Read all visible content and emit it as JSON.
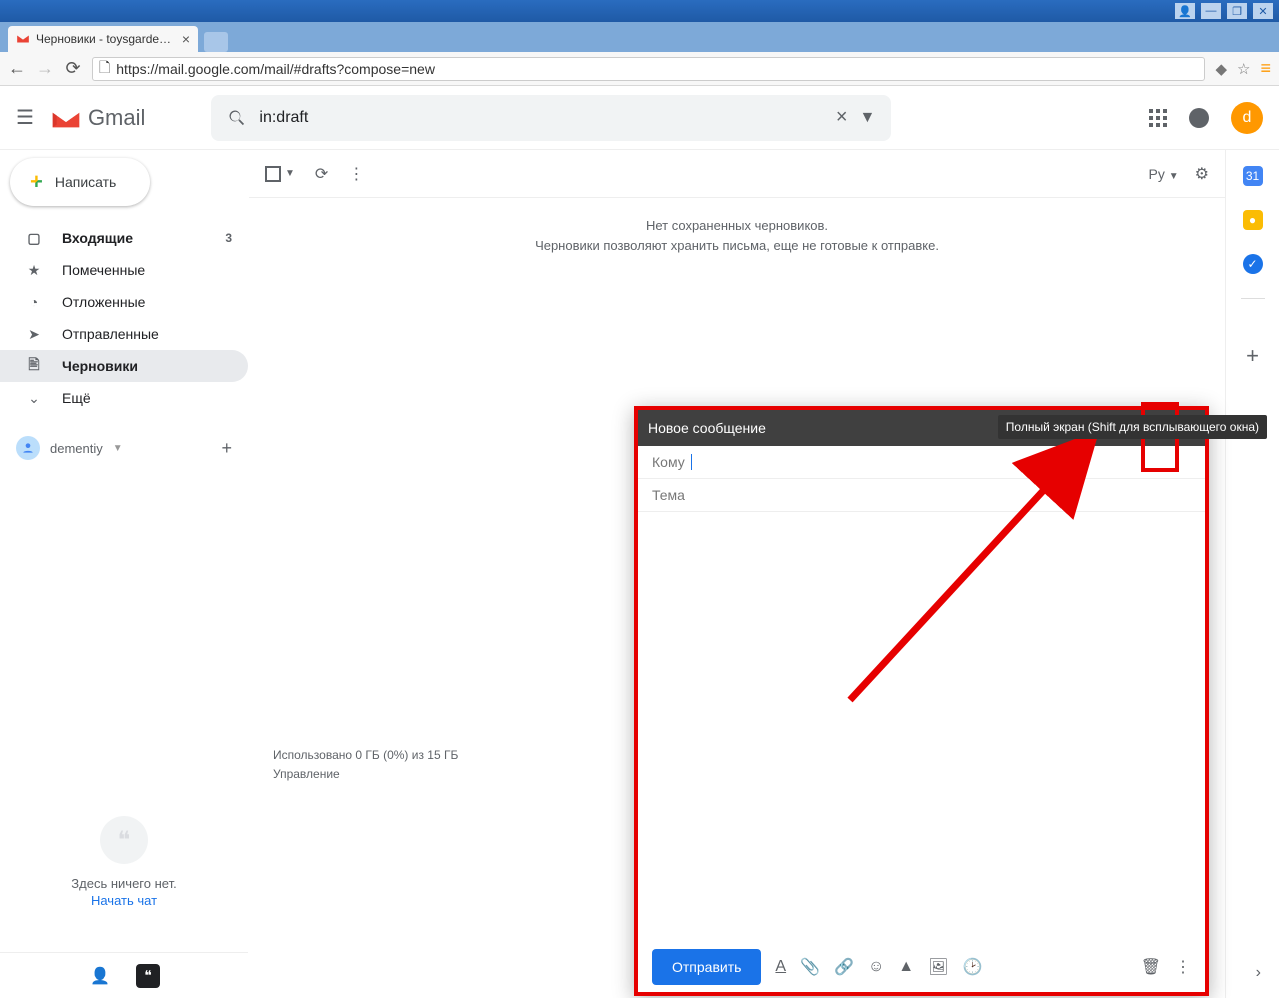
{
  "browser": {
    "tab_title": "Черновики - toysgardenclub",
    "url_display": "https://mail.google.com/mail/#drafts?compose=new"
  },
  "header": {
    "product": "Gmail",
    "search_value": "in:draft",
    "avatar_letter": "d"
  },
  "compose_btn": "Написать",
  "nav": {
    "inbox": "Входящие",
    "inbox_count": "3",
    "starred": "Помеченные",
    "snoozed": "Отложенные",
    "sent": "Отправленные",
    "drafts": "Черновики",
    "more": "Ещё"
  },
  "user": {
    "name": "dementiy"
  },
  "hangouts": {
    "empty": "Здесь ничего нет.",
    "start": "Начать чат"
  },
  "toolbar": {
    "lang": "Ру"
  },
  "empty": {
    "line1": "Нет сохраненных черновиков.",
    "line2": "Черновики позволяют хранить письма, еще не готовые к отправке."
  },
  "storage": {
    "line1": "Использовано 0 ГБ (0%) из 15 ГБ",
    "line2": "Управление"
  },
  "compose": {
    "title": "Новое сообщение",
    "to": "Кому",
    "subject": "Тема",
    "send": "Отправить"
  },
  "tooltip": "Полный экран (Shift для всплывающего окна)"
}
